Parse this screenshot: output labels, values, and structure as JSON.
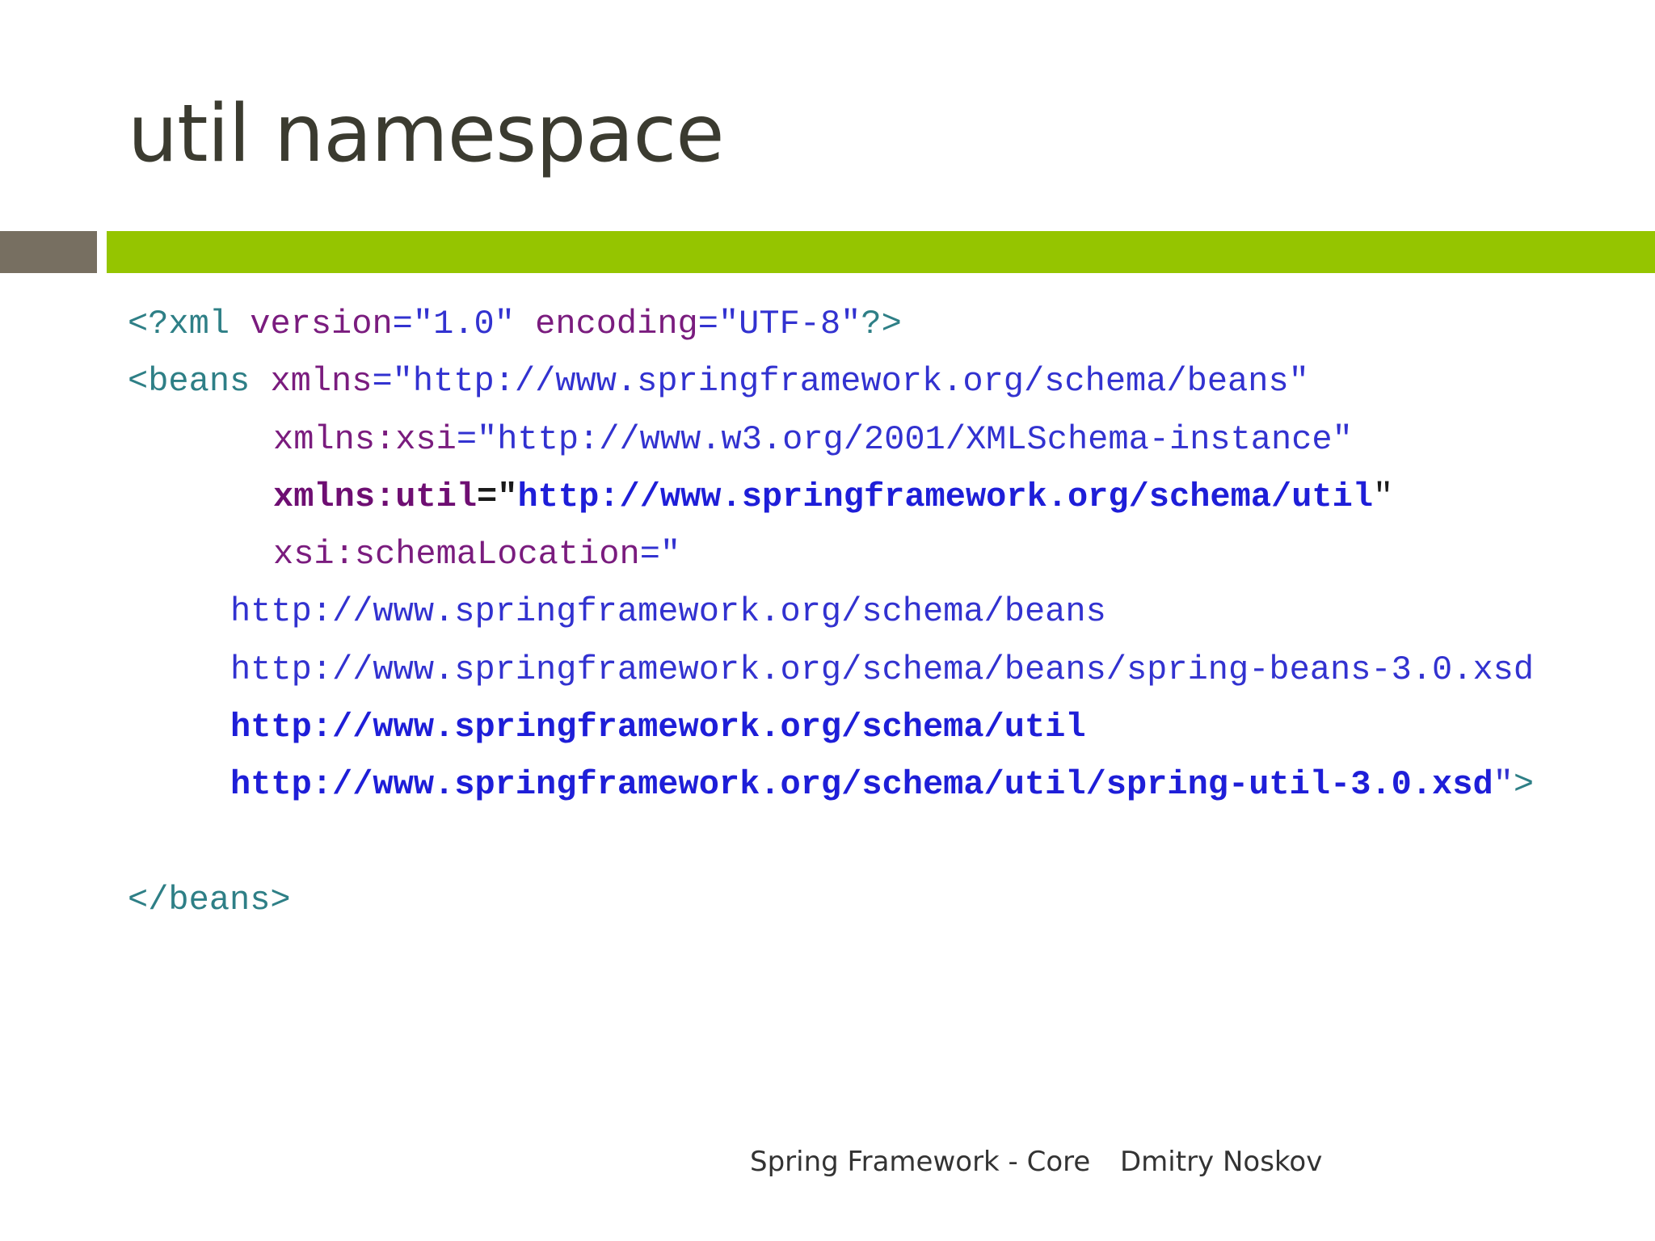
{
  "slide": {
    "title": "util namespace"
  },
  "theme": {
    "accent_green": "#95c500",
    "accent_gray": "#776f61",
    "title_color": "#3b3b30"
  },
  "code": {
    "l1": {
      "a": "<?xml ",
      "b": "version",
      "c": "=\"1.0\" ",
      "d": "encoding",
      "e": "=\"UTF-8\"",
      "f": "?>"
    },
    "l2": {
      "a": "<beans ",
      "b": "xmlns",
      "c": "=\"http://www.springframework.org/schema/beans\""
    },
    "l3": {
      "a": "xmlns:xsi",
      "b": "=\"http://www.w3.org/2001/XMLSchema-instance\""
    },
    "l4": {
      "a": "xmlns:util",
      "b": "=\"",
      "c": "http://www.springframework.org/schema/util",
      "d": "\""
    },
    "l5": {
      "a": "xsi:schemaLocation",
      "b": "=\""
    },
    "l6": "http://www.springframework.org/schema/beans",
    "l7": "http://www.springframework.org/schema/beans/spring-beans-3.0.xsd",
    "l8": "http://www.springframework.org/schema/util",
    "l9": {
      "a": "http://www.springframework.org/schema/util/spring-util-3.0.xsd",
      "b": "\"",
      "c": ">"
    },
    "l11": "</beans>"
  },
  "footer": {
    "course": "Spring Framework - Core",
    "author": "Dmitry Noskov"
  }
}
